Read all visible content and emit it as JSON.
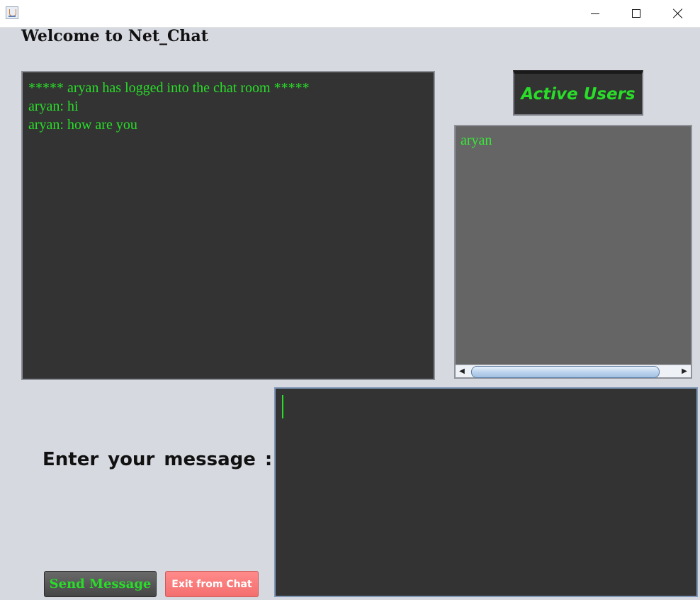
{
  "window": {
    "controls": {
      "minimize_icon": "minimize-icon",
      "maximize_icon": "maximize-icon",
      "close_icon": "close-icon"
    }
  },
  "header": {
    "welcome": "Welcome to Net_Chat"
  },
  "chat": {
    "lines": [
      "***** aryan has logged into the chat room *****",
      "aryan: hi",
      "aryan: how are you"
    ]
  },
  "active_users": {
    "title": "Active Users",
    "users": [
      "aryan"
    ]
  },
  "compose": {
    "label": "Enter your message :",
    "value": "",
    "send_label": "Send Message",
    "exit_label": "Exit from Chat"
  },
  "colors": {
    "panel_bg": "#333333",
    "text_green": "#29dd29",
    "window_bg": "#d6d9e0",
    "exit_red": "#f46f6f"
  }
}
